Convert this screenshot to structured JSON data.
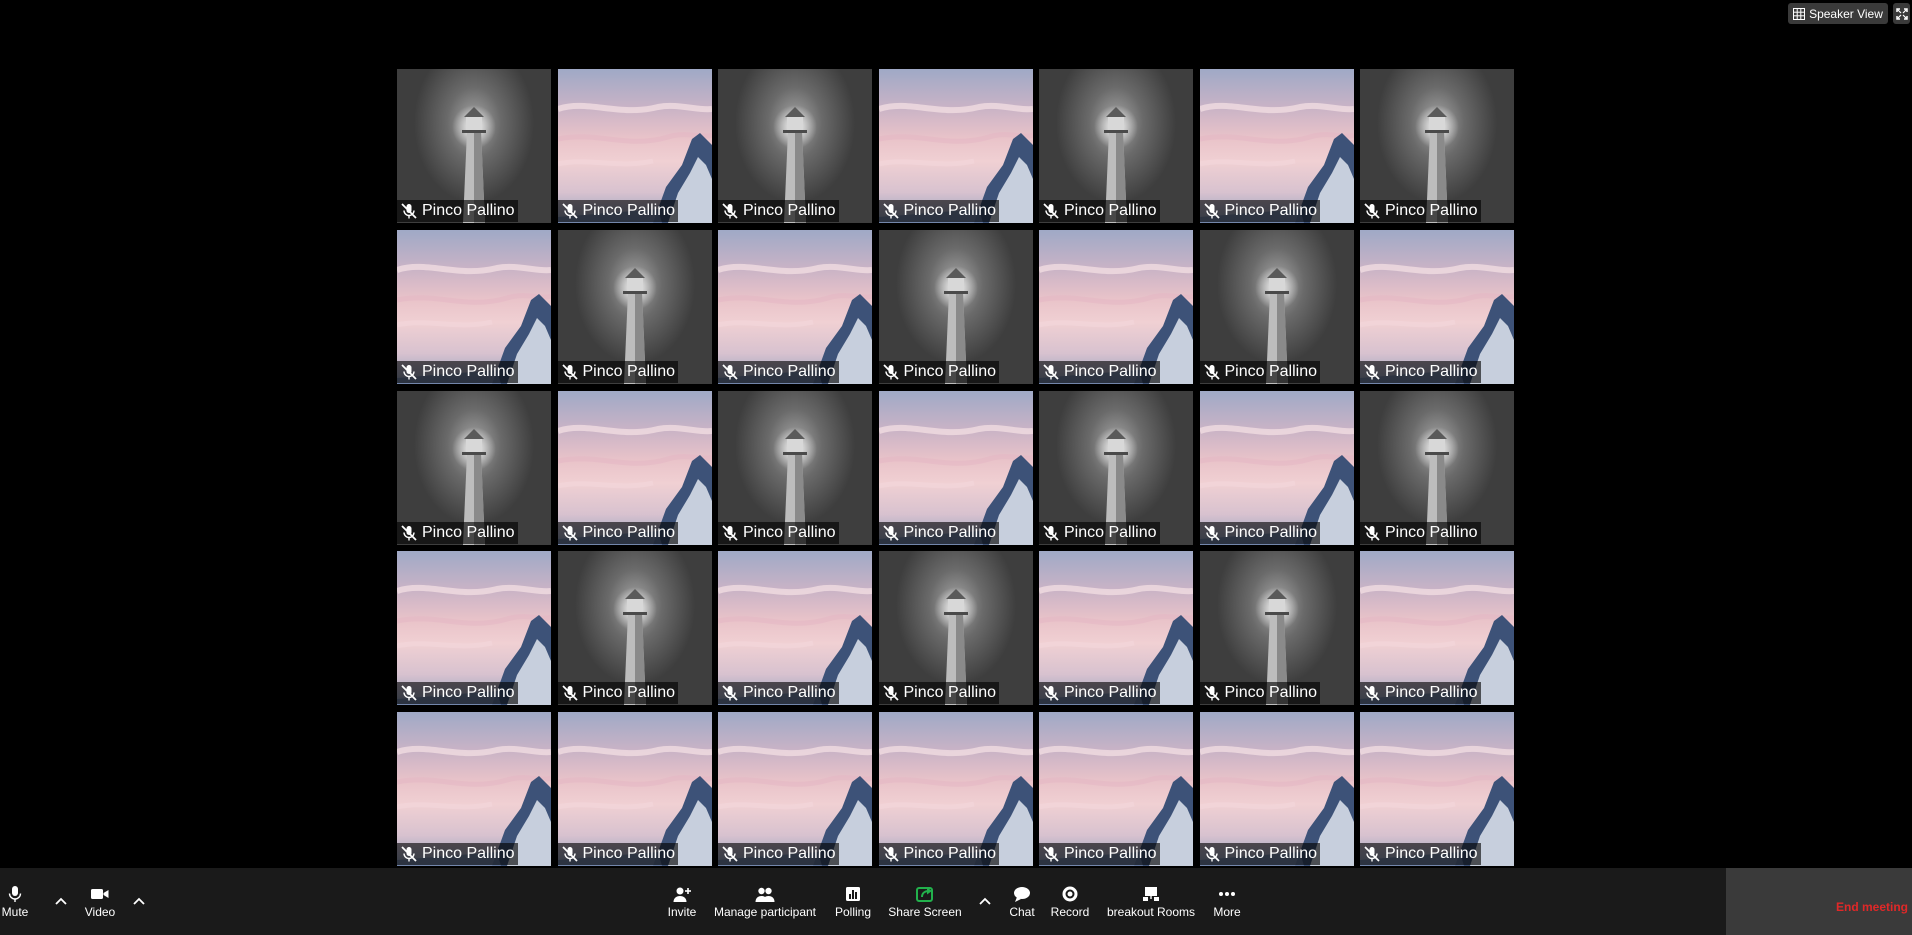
{
  "top_controls": {
    "speaker_view_label": "Speaker View",
    "speaker_view_icon": "grid-icon",
    "fullscreen_icon": "fullscreen-icon"
  },
  "gallery": {
    "participant_name": "Pinco Pallino",
    "rows": [
      [
        "lighthouse",
        "sky",
        "lighthouse",
        "sky",
        "lighthouse",
        "sky",
        "lighthouse"
      ],
      [
        "sky",
        "lighthouse",
        "sky",
        "lighthouse",
        "sky",
        "lighthouse",
        "sky"
      ],
      [
        "lighthouse",
        "sky",
        "lighthouse",
        "sky",
        "lighthouse",
        "sky",
        "lighthouse"
      ],
      [
        "sky",
        "lighthouse",
        "sky",
        "lighthouse",
        "sky",
        "lighthouse",
        "sky"
      ],
      [
        "sky",
        "sky",
        "sky",
        "sky",
        "sky",
        "sky",
        "sky"
      ]
    ],
    "muted_icon": "mic-muted-icon"
  },
  "toolbar": {
    "mute_label": "Mute",
    "video_label": "Video",
    "invite_label": "Invite",
    "manage_participant_label": "Manage participant",
    "polling_label": "Polling",
    "share_screen_label": "Share Screen",
    "chat_label": "Chat",
    "record_label": "Record",
    "breakout_rooms_label": "breakout Rooms",
    "more_label": "More",
    "end_meeting_label": "End meeting"
  },
  "colors": {
    "background": "#000000",
    "toolbar": "#1a1a1a",
    "share_screen_accent": "#22b14c",
    "end_meeting": "#e02828"
  }
}
